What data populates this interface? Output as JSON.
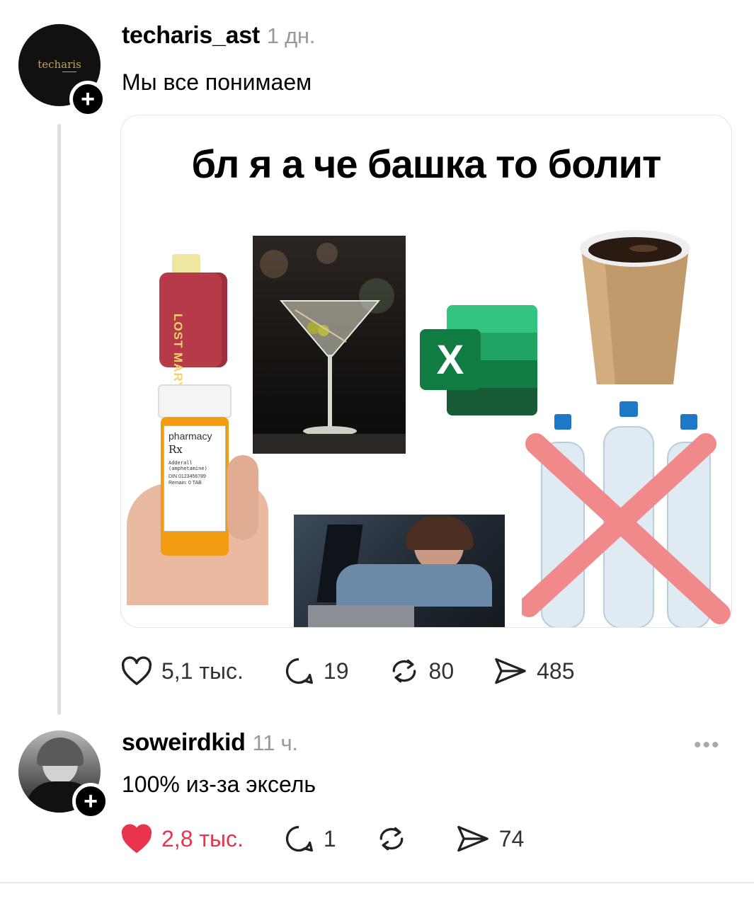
{
  "post1": {
    "username": "techaris_ast",
    "time": "1 дн.",
    "avatar_text": "techaris",
    "text": "Мы все понимаем",
    "image": {
      "title": "бл я а че башка то болит",
      "vape_label": "LOST MARY",
      "pharmacy_label": "pharmacy",
      "rx_label": "Rx",
      "drug_label": "Adderall (amphetamine)",
      "din_label": "DIN 0123456789",
      "remain_label": "Remain: 0 TAB",
      "excel_letter": "X"
    },
    "actions": {
      "likes": "5,1 тыс.",
      "comments": "19",
      "reposts": "80",
      "shares": "485"
    }
  },
  "post2": {
    "username": "soweirdkid",
    "time": "11 ч.",
    "text": "100% из-за эксель",
    "more": "•••",
    "actions": {
      "likes": "2,8 тыс.",
      "comments": "1",
      "reposts": "",
      "shares": "74"
    }
  },
  "colors": {
    "like_red": "#e8344e",
    "excel_green": "#1d7044",
    "muted_gray": "#9a9a9a"
  }
}
